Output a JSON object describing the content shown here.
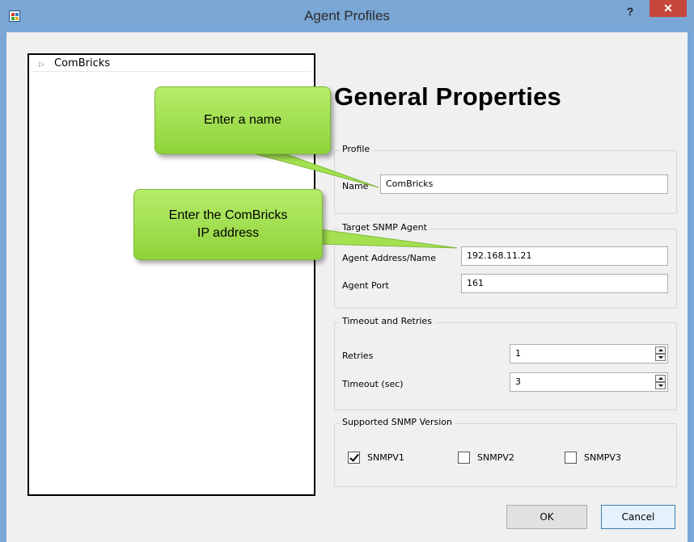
{
  "window": {
    "title": "Agent Profiles",
    "help_label": "?",
    "close_label": "✕"
  },
  "tree": {
    "items": [
      {
        "label": "ComBricks"
      }
    ]
  },
  "heading": "General Properties",
  "profile": {
    "group_title": "Profile",
    "name_label": "Name",
    "name_value": "ComBricks"
  },
  "target": {
    "group_title": "Target SNMP Agent",
    "address_label": "Agent Address/Name",
    "address_value": "192.168.11.21",
    "port_label": "Agent Port",
    "port_value": "161"
  },
  "timeout": {
    "group_title": "Timeout and Retries",
    "retries_label": "Retries",
    "retries_value": "1",
    "timeout_label": "Timeout (sec)",
    "timeout_value": "3"
  },
  "versions": {
    "group_title": "Supported SNMP Version",
    "options": [
      {
        "label": "SNMPV1",
        "checked": true
      },
      {
        "label": "SNMPV2",
        "checked": false
      },
      {
        "label": "SNMPV3",
        "checked": false
      }
    ]
  },
  "buttons": {
    "ok": "OK",
    "cancel": "Cancel"
  },
  "callouts": {
    "name_hint": "Enter a name",
    "ip_hint_line1": "Enter the ComBricks",
    "ip_hint_line2": "IP address"
  },
  "colors": {
    "titlebar": "#7aa7d6",
    "close": "#c7463b",
    "callout": "#8fd33a",
    "client_bg": "#f0f0f0"
  }
}
